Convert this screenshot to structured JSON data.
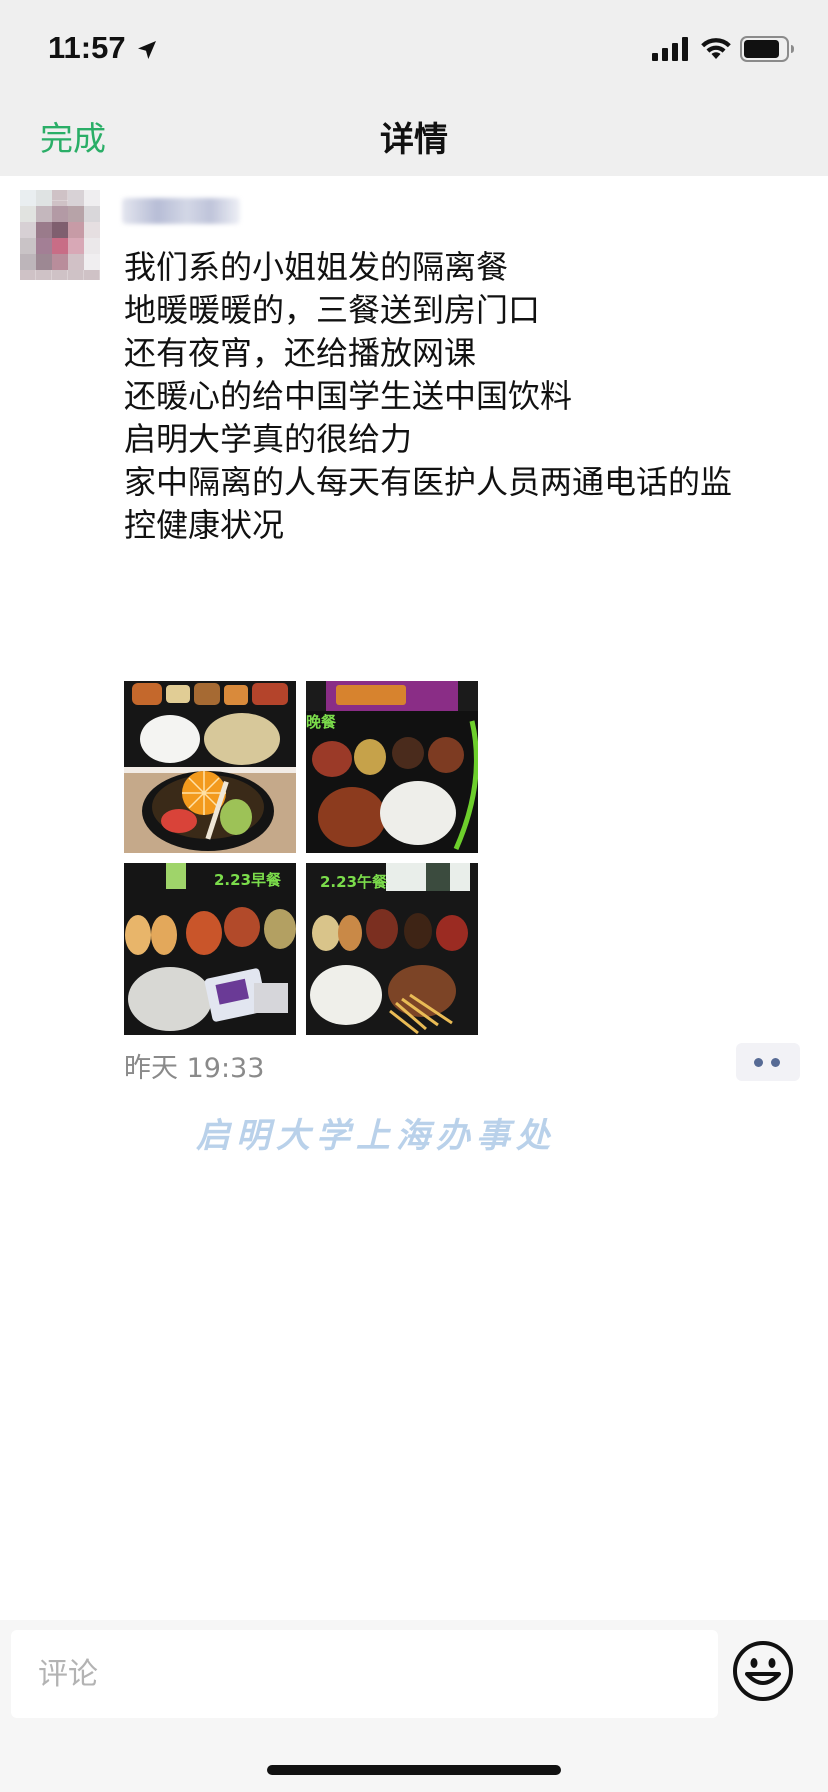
{
  "status_bar": {
    "time": "11:57",
    "icons": [
      "location-arrow-icon",
      "cellular-signal-icon",
      "wifi-icon",
      "battery-icon"
    ]
  },
  "nav": {
    "done_label": "完成",
    "title": "详情",
    "accent_color": "#2aae67"
  },
  "post": {
    "author_name": "",
    "lines": [
      "我们系的小姐姐发的隔离餐",
      "地暖暖暖的，三餐送到房门口",
      "还有夜宵，还给播放网课",
      "还暖心的给中国学生送中国饮料",
      "启明大学真的很给力",
      "家中隔离的人每天有医护人员两通电话的监",
      "控健康状况"
    ],
    "photo_labels": [
      "晚餐",
      "2.23早餐",
      "2.23午餐"
    ],
    "time": "昨天 19:33",
    "more_icon": "more-dots-icon"
  },
  "watermark": "启明大学上海办事处",
  "comment": {
    "placeholder": "评论",
    "emoji_icon": "emoji-smiley-icon"
  }
}
